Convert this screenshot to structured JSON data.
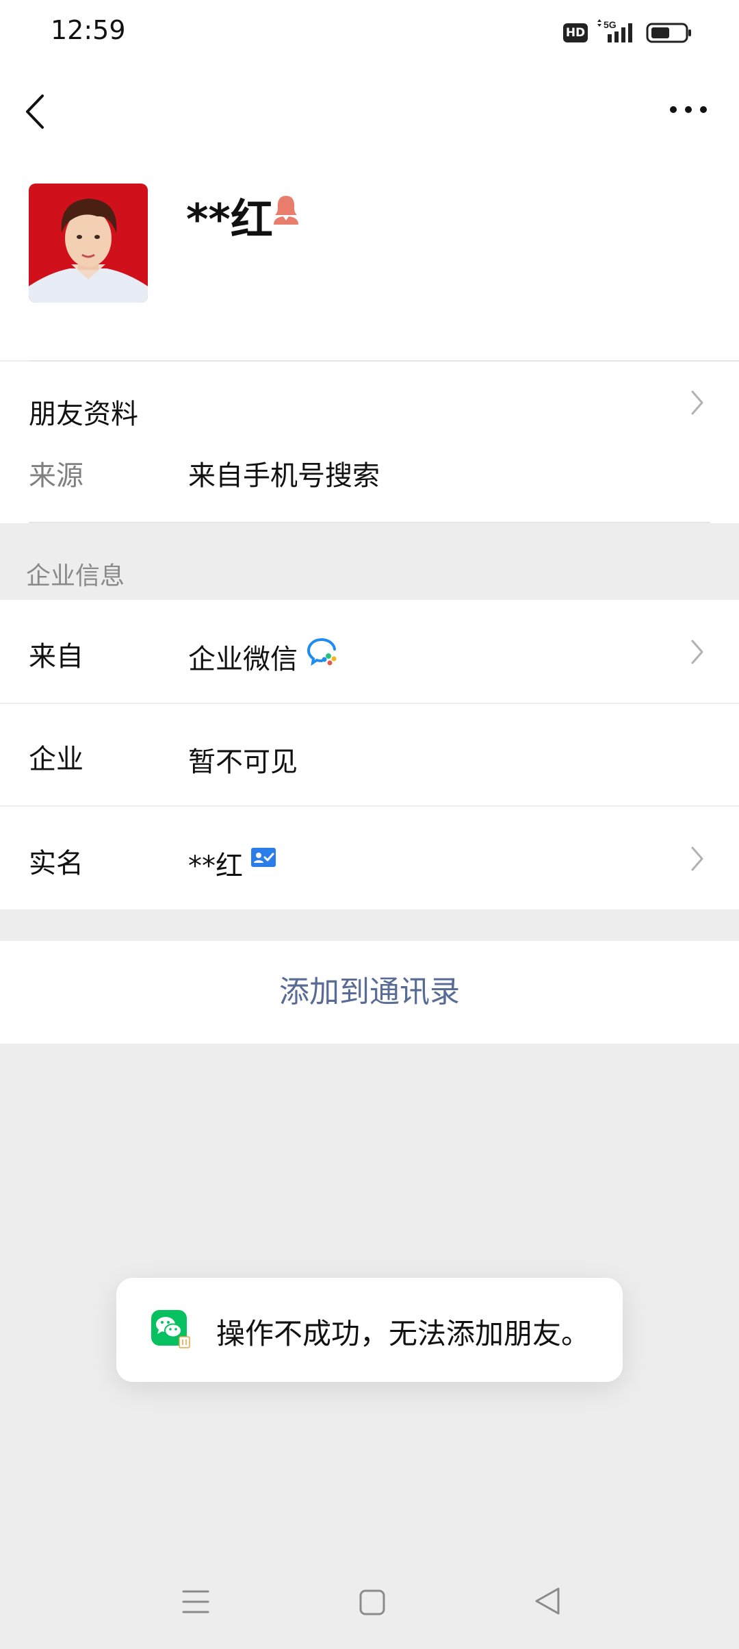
{
  "status_bar": {
    "time": "12:59",
    "hd_label": "HD",
    "network_label": "5G"
  },
  "profile": {
    "name": "**红"
  },
  "friend_info": {
    "title": "朋友资料",
    "source_label": "来源",
    "source_value": "来自手机号搜索"
  },
  "enterprise": {
    "header": "企业信息",
    "rows": [
      {
        "label": "来自",
        "value": "企业微信"
      },
      {
        "label": "企业",
        "value": "暂不可见"
      },
      {
        "label": "实名",
        "value": "**红"
      }
    ]
  },
  "actions": {
    "add_to_contacts": "添加到通讯录"
  },
  "toast": {
    "message": "操作不成功，无法添加朋友。"
  },
  "colors": {
    "link": "#576b95",
    "wechat_green": "#07c160",
    "gender_female": "#e97d6b",
    "page_bg": "#ededed"
  },
  "icons": [
    "back-icon",
    "more-icon",
    "gender-female-icon",
    "chevron-right-icon",
    "wecom-icon",
    "id-verified-icon",
    "wechat-icon",
    "nav-menu-icon",
    "nav-home-icon",
    "nav-back-icon"
  ]
}
